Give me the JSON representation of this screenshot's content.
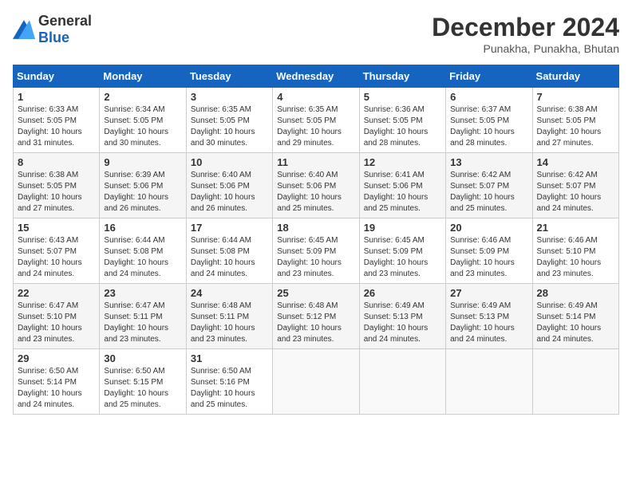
{
  "header": {
    "logo_general": "General",
    "logo_blue": "Blue",
    "month": "December 2024",
    "location": "Punakha, Punakha, Bhutan"
  },
  "weekdays": [
    "Sunday",
    "Monday",
    "Tuesday",
    "Wednesday",
    "Thursday",
    "Friday",
    "Saturday"
  ],
  "weeks": [
    [
      {
        "day": "1",
        "sunrise": "6:33 AM",
        "sunset": "5:05 PM",
        "daylight": "10 hours and 31 minutes."
      },
      {
        "day": "2",
        "sunrise": "6:34 AM",
        "sunset": "5:05 PM",
        "daylight": "10 hours and 30 minutes."
      },
      {
        "day": "3",
        "sunrise": "6:35 AM",
        "sunset": "5:05 PM",
        "daylight": "10 hours and 30 minutes."
      },
      {
        "day": "4",
        "sunrise": "6:35 AM",
        "sunset": "5:05 PM",
        "daylight": "10 hours and 29 minutes."
      },
      {
        "day": "5",
        "sunrise": "6:36 AM",
        "sunset": "5:05 PM",
        "daylight": "10 hours and 28 minutes."
      },
      {
        "day": "6",
        "sunrise": "6:37 AM",
        "sunset": "5:05 PM",
        "daylight": "10 hours and 28 minutes."
      },
      {
        "day": "7",
        "sunrise": "6:38 AM",
        "sunset": "5:05 PM",
        "daylight": "10 hours and 27 minutes."
      }
    ],
    [
      {
        "day": "8",
        "sunrise": "6:38 AM",
        "sunset": "5:05 PM",
        "daylight": "10 hours and 27 minutes."
      },
      {
        "day": "9",
        "sunrise": "6:39 AM",
        "sunset": "5:06 PM",
        "daylight": "10 hours and 26 minutes."
      },
      {
        "day": "10",
        "sunrise": "6:40 AM",
        "sunset": "5:06 PM",
        "daylight": "10 hours and 26 minutes."
      },
      {
        "day": "11",
        "sunrise": "6:40 AM",
        "sunset": "5:06 PM",
        "daylight": "10 hours and 25 minutes."
      },
      {
        "day": "12",
        "sunrise": "6:41 AM",
        "sunset": "5:06 PM",
        "daylight": "10 hours and 25 minutes."
      },
      {
        "day": "13",
        "sunrise": "6:42 AM",
        "sunset": "5:07 PM",
        "daylight": "10 hours and 25 minutes."
      },
      {
        "day": "14",
        "sunrise": "6:42 AM",
        "sunset": "5:07 PM",
        "daylight": "10 hours and 24 minutes."
      }
    ],
    [
      {
        "day": "15",
        "sunrise": "6:43 AM",
        "sunset": "5:07 PM",
        "daylight": "10 hours and 24 minutes."
      },
      {
        "day": "16",
        "sunrise": "6:44 AM",
        "sunset": "5:08 PM",
        "daylight": "10 hours and 24 minutes."
      },
      {
        "day": "17",
        "sunrise": "6:44 AM",
        "sunset": "5:08 PM",
        "daylight": "10 hours and 24 minutes."
      },
      {
        "day": "18",
        "sunrise": "6:45 AM",
        "sunset": "5:09 PM",
        "daylight": "10 hours and 23 minutes."
      },
      {
        "day": "19",
        "sunrise": "6:45 AM",
        "sunset": "5:09 PM",
        "daylight": "10 hours and 23 minutes."
      },
      {
        "day": "20",
        "sunrise": "6:46 AM",
        "sunset": "5:09 PM",
        "daylight": "10 hours and 23 minutes."
      },
      {
        "day": "21",
        "sunrise": "6:46 AM",
        "sunset": "5:10 PM",
        "daylight": "10 hours and 23 minutes."
      }
    ],
    [
      {
        "day": "22",
        "sunrise": "6:47 AM",
        "sunset": "5:10 PM",
        "daylight": "10 hours and 23 minutes."
      },
      {
        "day": "23",
        "sunrise": "6:47 AM",
        "sunset": "5:11 PM",
        "daylight": "10 hours and 23 minutes."
      },
      {
        "day": "24",
        "sunrise": "6:48 AM",
        "sunset": "5:11 PM",
        "daylight": "10 hours and 23 minutes."
      },
      {
        "day": "25",
        "sunrise": "6:48 AM",
        "sunset": "5:12 PM",
        "daylight": "10 hours and 23 minutes."
      },
      {
        "day": "26",
        "sunrise": "6:49 AM",
        "sunset": "5:13 PM",
        "daylight": "10 hours and 24 minutes."
      },
      {
        "day": "27",
        "sunrise": "6:49 AM",
        "sunset": "5:13 PM",
        "daylight": "10 hours and 24 minutes."
      },
      {
        "day": "28",
        "sunrise": "6:49 AM",
        "sunset": "5:14 PM",
        "daylight": "10 hours and 24 minutes."
      }
    ],
    [
      {
        "day": "29",
        "sunrise": "6:50 AM",
        "sunset": "5:14 PM",
        "daylight": "10 hours and 24 minutes."
      },
      {
        "day": "30",
        "sunrise": "6:50 AM",
        "sunset": "5:15 PM",
        "daylight": "10 hours and 25 minutes."
      },
      {
        "day": "31",
        "sunrise": "6:50 AM",
        "sunset": "5:16 PM",
        "daylight": "10 hours and 25 minutes."
      },
      null,
      null,
      null,
      null
    ]
  ]
}
